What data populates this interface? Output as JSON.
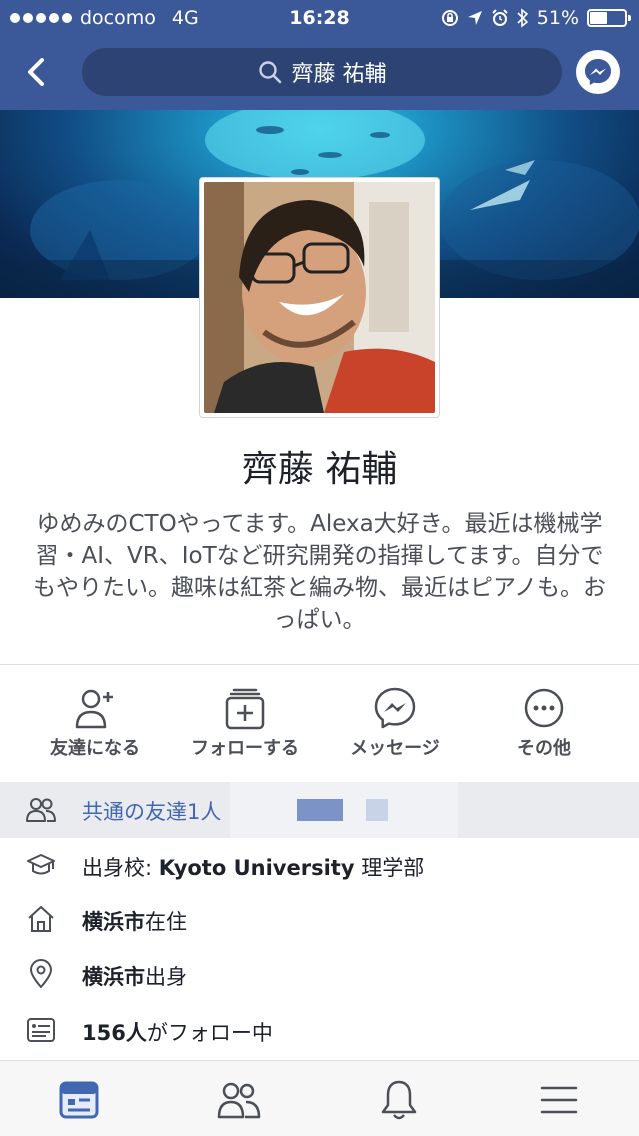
{
  "status_bar": {
    "carrier": "docomo",
    "network": "4G",
    "time": "16:28",
    "battery": "51%",
    "battery_level": 0.51
  },
  "nav": {
    "search_text": "齊藤 祐輔"
  },
  "profile": {
    "name": "齊藤 祐輔",
    "bio": "ゆめみのCTOやってます。Alexa大好き。最近は機械学習・AI、VR、IoTなど研究開発の指揮してます。自分でもやりたい。趣味は紅茶と編み物、最近はピアノも。おっぱい。"
  },
  "actions": [
    {
      "label": "友達になる",
      "icon": "add-friend-icon"
    },
    {
      "label": "フォローする",
      "icon": "follow-icon"
    },
    {
      "label": "メッセージ",
      "icon": "messenger-icon"
    },
    {
      "label": "その他",
      "icon": "more-icon"
    }
  ],
  "mutual": {
    "text": "共通の友達1人"
  },
  "info": {
    "school_prefix": "出身校: ",
    "school_name": "Kyoto University",
    "school_suffix": " 理学部",
    "lives_city": "横浜市",
    "lives_suffix": "在住",
    "from_city": "横浜市",
    "from_suffix": "出身",
    "followers_count": "156人",
    "followers_suffix": "がフォロー中"
  },
  "tabs": [
    {
      "icon": "news-feed-icon",
      "active": true
    },
    {
      "icon": "friends-icon",
      "active": false
    },
    {
      "icon": "notifications-icon",
      "active": false
    },
    {
      "icon": "menu-icon",
      "active": false
    }
  ],
  "colors": {
    "brand": "#3b5998",
    "link": "#4267b2",
    "muted": "#4b4f56"
  }
}
